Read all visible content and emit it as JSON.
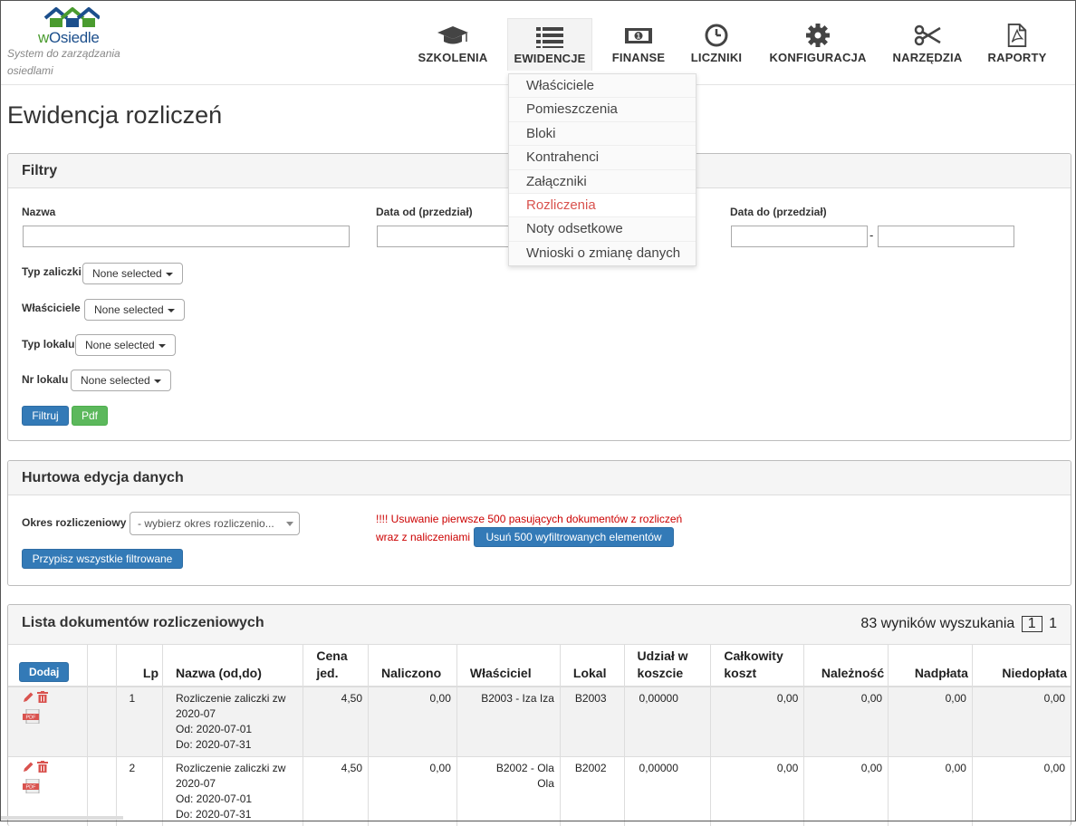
{
  "app": {
    "logo_prefix": "w",
    "logo_name": "Osiedle",
    "tagline": "System do zarządzania osiedlami"
  },
  "nav": [
    {
      "label": "SZKOLENIA",
      "icon": "graduation-cap-icon"
    },
    {
      "label": "EWIDENCJE",
      "icon": "list-icon"
    },
    {
      "label": "FINANSE",
      "icon": "money-icon"
    },
    {
      "label": "LICZNIKI",
      "icon": "clock-icon"
    },
    {
      "label": "KONFIGURACJA",
      "icon": "gear-icon"
    },
    {
      "label": "NARZĘDZIA",
      "icon": "scissors-icon"
    },
    {
      "label": "RAPORTY",
      "icon": "pdf-file-icon"
    }
  ],
  "dropdown": [
    "Właściciele",
    "Pomieszczenia",
    "Bloki",
    "Kontrahenci",
    "Załączniki",
    "Rozliczenia",
    "Noty odsetkowe",
    "Wnioski o zmianę danych"
  ],
  "dropdown_active": "Rozliczenia",
  "page_title": "Ewidencja rozliczeń",
  "filters": {
    "heading": "Filtry",
    "name_label": "Nazwa",
    "name_value": "",
    "date_from_label": "Data od (przedział)",
    "date_to_label": "Data do (przedział)",
    "date_sep": "-",
    "typ_zaliczki_label": "Typ zaliczki",
    "wlasciciele_label": "Właściciele",
    "typ_lokalu_label": "Typ lokalu",
    "nr_lokalu_label": "Nr lokalu",
    "none_selected": "None selected",
    "filter_btn": "Filtruj",
    "pdf_btn": "Pdf"
  },
  "bulk": {
    "heading": "Hurtowa edycja danych",
    "period_label": "Okres rozliczeniowy",
    "period_placeholder": "- wybierz okres rozliczenio...",
    "assign_btn": "Przypisz wszystkie filtrowane",
    "warning_line1": "!!!! Usuwanie pierwsze 500 pasujących dokumentów z rozliczeń",
    "warning_line2": "wraz z naliczeniami",
    "delete_btn": "Usuń 500 wyfiltrowanych elementów"
  },
  "list": {
    "heading": "Lista dokumentów rozliczeniowych",
    "results_text": "83 wyników wyszukania",
    "current_page": "1",
    "total_pages": "1",
    "add_btn": "Dodaj",
    "columns": [
      "Lp",
      "Nazwa (od,do)",
      "Cena jed.",
      "Naliczono",
      "Właściciel",
      "Lokal",
      "Udział w koszcie",
      "Całkowity koszt",
      "Należność",
      "Nadpłata",
      "Niedopłata"
    ],
    "rows": [
      {
        "lp": "1",
        "name": "Rozliczenie zaliczki zw 2020-07",
        "od": "Od: 2020-07-01",
        "do": "Do: 2020-07-31",
        "cena": "4,50",
        "naliczono": "0,00",
        "wlasciciel": "B2003 - Iza Iza",
        "lokal": "B2003",
        "udzial": "0,00000",
        "calkowity": "0,00",
        "naleznosc": "0,00",
        "nadplata": "0,00",
        "niedoplata": "0,00"
      },
      {
        "lp": "2",
        "name": "Rozliczenie zaliczki zw 2020-07",
        "od": "Od: 2020-07-01",
        "do": "Do: 2020-07-31",
        "cena": "4,50",
        "naliczono": "0,00",
        "wlasciciel": "B2002 - Ola Ola",
        "lokal": "B2002",
        "udzial": "0,00000",
        "calkowity": "0,00",
        "naleznosc": "0,00",
        "nadplata": "0,00",
        "niedoplata": "0,00"
      }
    ]
  },
  "colors": {
    "primary": "#337ab7",
    "success": "#5cb85c",
    "danger": "#c00000",
    "active_menu": "#d9534f",
    "logo_blue": "#1c4f8c",
    "logo_green": "#4a9b2f"
  }
}
